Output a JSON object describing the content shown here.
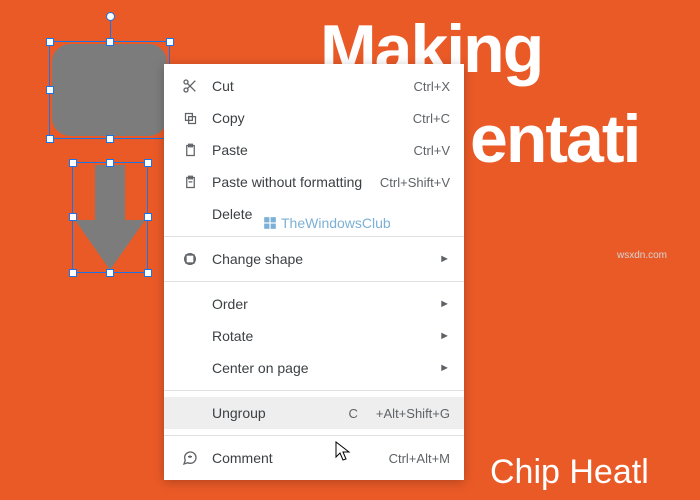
{
  "slide": {
    "title_line1": "Making",
    "title_line2": "entati",
    "author_text": "Chip Heatl"
  },
  "menu": {
    "cut": {
      "label": "Cut",
      "shortcut": "Ctrl+X"
    },
    "copy": {
      "label": "Copy",
      "shortcut": "Ctrl+C"
    },
    "paste": {
      "label": "Paste",
      "shortcut": "Ctrl+V"
    },
    "paste_nf": {
      "label": "Paste without formatting",
      "shortcut": "Ctrl+Shift+V"
    },
    "delete": {
      "label": "Delete"
    },
    "change_shape": {
      "label": "Change shape"
    },
    "order": {
      "label": "Order"
    },
    "rotate": {
      "label": "Rotate"
    },
    "center": {
      "label": "Center on page"
    },
    "ungroup": {
      "label": "Ungroup",
      "shortcut_partial_left": "C",
      "shortcut_partial_right": "+Alt+Shift+G"
    },
    "comment": {
      "label": "Comment",
      "shortcut": "Ctrl+Alt+M"
    }
  },
  "watermark": {
    "text": "TheWindowsClub"
  },
  "site_watermark": {
    "text": "wsxdn.com"
  }
}
